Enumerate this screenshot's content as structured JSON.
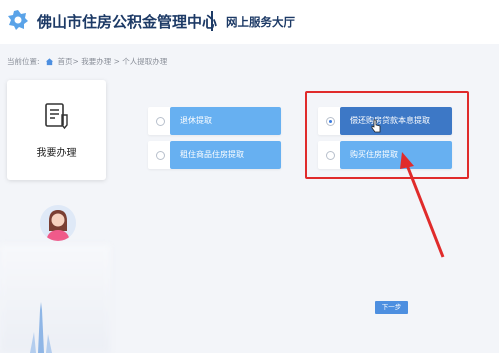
{
  "header": {
    "title": "佛山市住房公积金管理中心",
    "separator": "|",
    "subtitle": "网上服务大厅"
  },
  "breadcrumb": {
    "prefix": "当前位置:",
    "home": "首页",
    "path": " > 我要办理 > 个人提取办理"
  },
  "sidebar": {
    "card_label": "我要办理"
  },
  "options": [
    {
      "label": "退休提取",
      "checked": false
    },
    {
      "label": "租住商品住房提取",
      "checked": false
    },
    {
      "label": "偿还购房贷款本息提取",
      "checked": true
    },
    {
      "label": "购买住房提取",
      "checked": false
    }
  ],
  "next_button": "下一步",
  "colors": {
    "brand": "#1d3a66",
    "option_blue": "#67b0f1",
    "option_selected": "#3d78c6",
    "annotation_red": "#e02b2b"
  }
}
